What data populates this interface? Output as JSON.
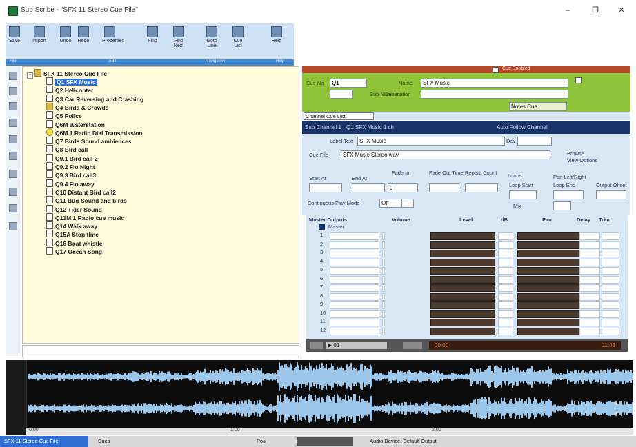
{
  "window": {
    "title": "Sub Scribe - \"SFX 11 Stereo Cue File\"",
    "minimize": "–",
    "maximize": "❐",
    "close": "✕"
  },
  "ribbon": {
    "buttons": [
      "Save",
      "Import",
      "Undo",
      "Redo",
      "Properties",
      "Find",
      "Find Next",
      "Goto Line",
      "Cue List",
      "Help"
    ],
    "groups": [
      "File",
      "Edit",
      "Navigation",
      "Help"
    ]
  },
  "tree": {
    "root": "SFX 11 Stereo Cue File",
    "selected_index": 0,
    "nodes": [
      {
        "label": "Q1 SFX Music",
        "icon": "note"
      },
      {
        "label": "Q2 Helicopter",
        "icon": "note"
      },
      {
        "label": "Q3 Car Reversing and Crashing",
        "icon": "note"
      },
      {
        "label": "Q4 Birds & Crowds",
        "icon": "folder"
      },
      {
        "label": "Q5 Police",
        "icon": "note"
      },
      {
        "label": "Q6M Waterstation",
        "icon": "note"
      },
      {
        "label": "Q6M.1 Radio Dial Transmission",
        "icon": "bulb"
      },
      {
        "label": "Q7 Birds Sound ambiences",
        "icon": "note"
      },
      {
        "label": "Q8 Bird call",
        "icon": "note"
      },
      {
        "label": "Q9.1 Bird call 2",
        "icon": "note"
      },
      {
        "label": "Q9.2 Flo Night",
        "icon": "note"
      },
      {
        "label": "Q9.3 Bird call3",
        "icon": "note"
      },
      {
        "label": "Q9.4 Flo away",
        "icon": "note"
      },
      {
        "label": "Q10 Distant Bird call2",
        "icon": "note"
      },
      {
        "label": "Q11 Bug Sound and birds",
        "icon": "note"
      },
      {
        "label": "Q12 Tiger Sound",
        "icon": "note"
      },
      {
        "label": "Q13M.1 Radio cue music",
        "icon": "note"
      },
      {
        "label": "Q14 Walk away",
        "icon": "note"
      },
      {
        "label": "Q15A Stop time",
        "icon": "note"
      },
      {
        "label": "Q16 Boat whistle",
        "icon": "note"
      },
      {
        "label": "Q17 Ocean Song",
        "icon": "note"
      }
    ]
  },
  "cue_header": {
    "section": "Cue Enabled",
    "cue_no_label": "Cue No",
    "cue_no": "Q1",
    "name_label": "Name",
    "name_value": "SFX Music",
    "sub_label": "Sub Number",
    "description_label": "Description",
    "notes_button": "Notes Cue",
    "details_tab": "Channel Cue List"
  },
  "channel": {
    "header_left": "Sub Channel 1 · Q1 SFX Music 1 ch",
    "header_right": "Auto Follow Channel",
    "label_field": "Label Text",
    "label_value": "SFX Music",
    "dev_field": "Dev",
    "cue_file_label": "Cue File",
    "cue_file_value": "SFX Music Stereo.wav",
    "browse_button": "Browse",
    "view_button": "View Options",
    "start_label": "Start At",
    "end_label": "End At",
    "fade_label": "Fade In",
    "fade_value": "0",
    "fade_ms_label": "Fade Out Time",
    "repeat_label": "Repeat Count",
    "loops_label": "Loops",
    "loop_start_label": "Loop Start",
    "loop_end_label": "Loop End",
    "output_label": "Output Offset",
    "continuous_label": "Continuous Play Mode",
    "continuous_value": "Off",
    "pan_label": "Pan Left/Right",
    "mix_label": "Mix"
  },
  "grid": {
    "headers": [
      "Master Outputs",
      "Volume",
      "Level",
      "dB",
      "Pan",
      "Delay",
      "Trim"
    ],
    "master_row": "Master",
    "rows": [
      "1",
      "2",
      "3",
      "4",
      "5",
      "6",
      "7",
      "8",
      "9",
      "10",
      "11",
      "12"
    ]
  },
  "transport": {
    "field": "▶ 01",
    "time_left": "00:00",
    "time_right": "11:43"
  },
  "wave_ruler": {
    "marks": [
      "0:00",
      "1:00",
      "2:00"
    ]
  },
  "status": {
    "left": "SFX 11 Stereo Cue File",
    "mode": "Cues",
    "pos_label": "Pos",
    "right": "Audio Device: Default Output"
  }
}
